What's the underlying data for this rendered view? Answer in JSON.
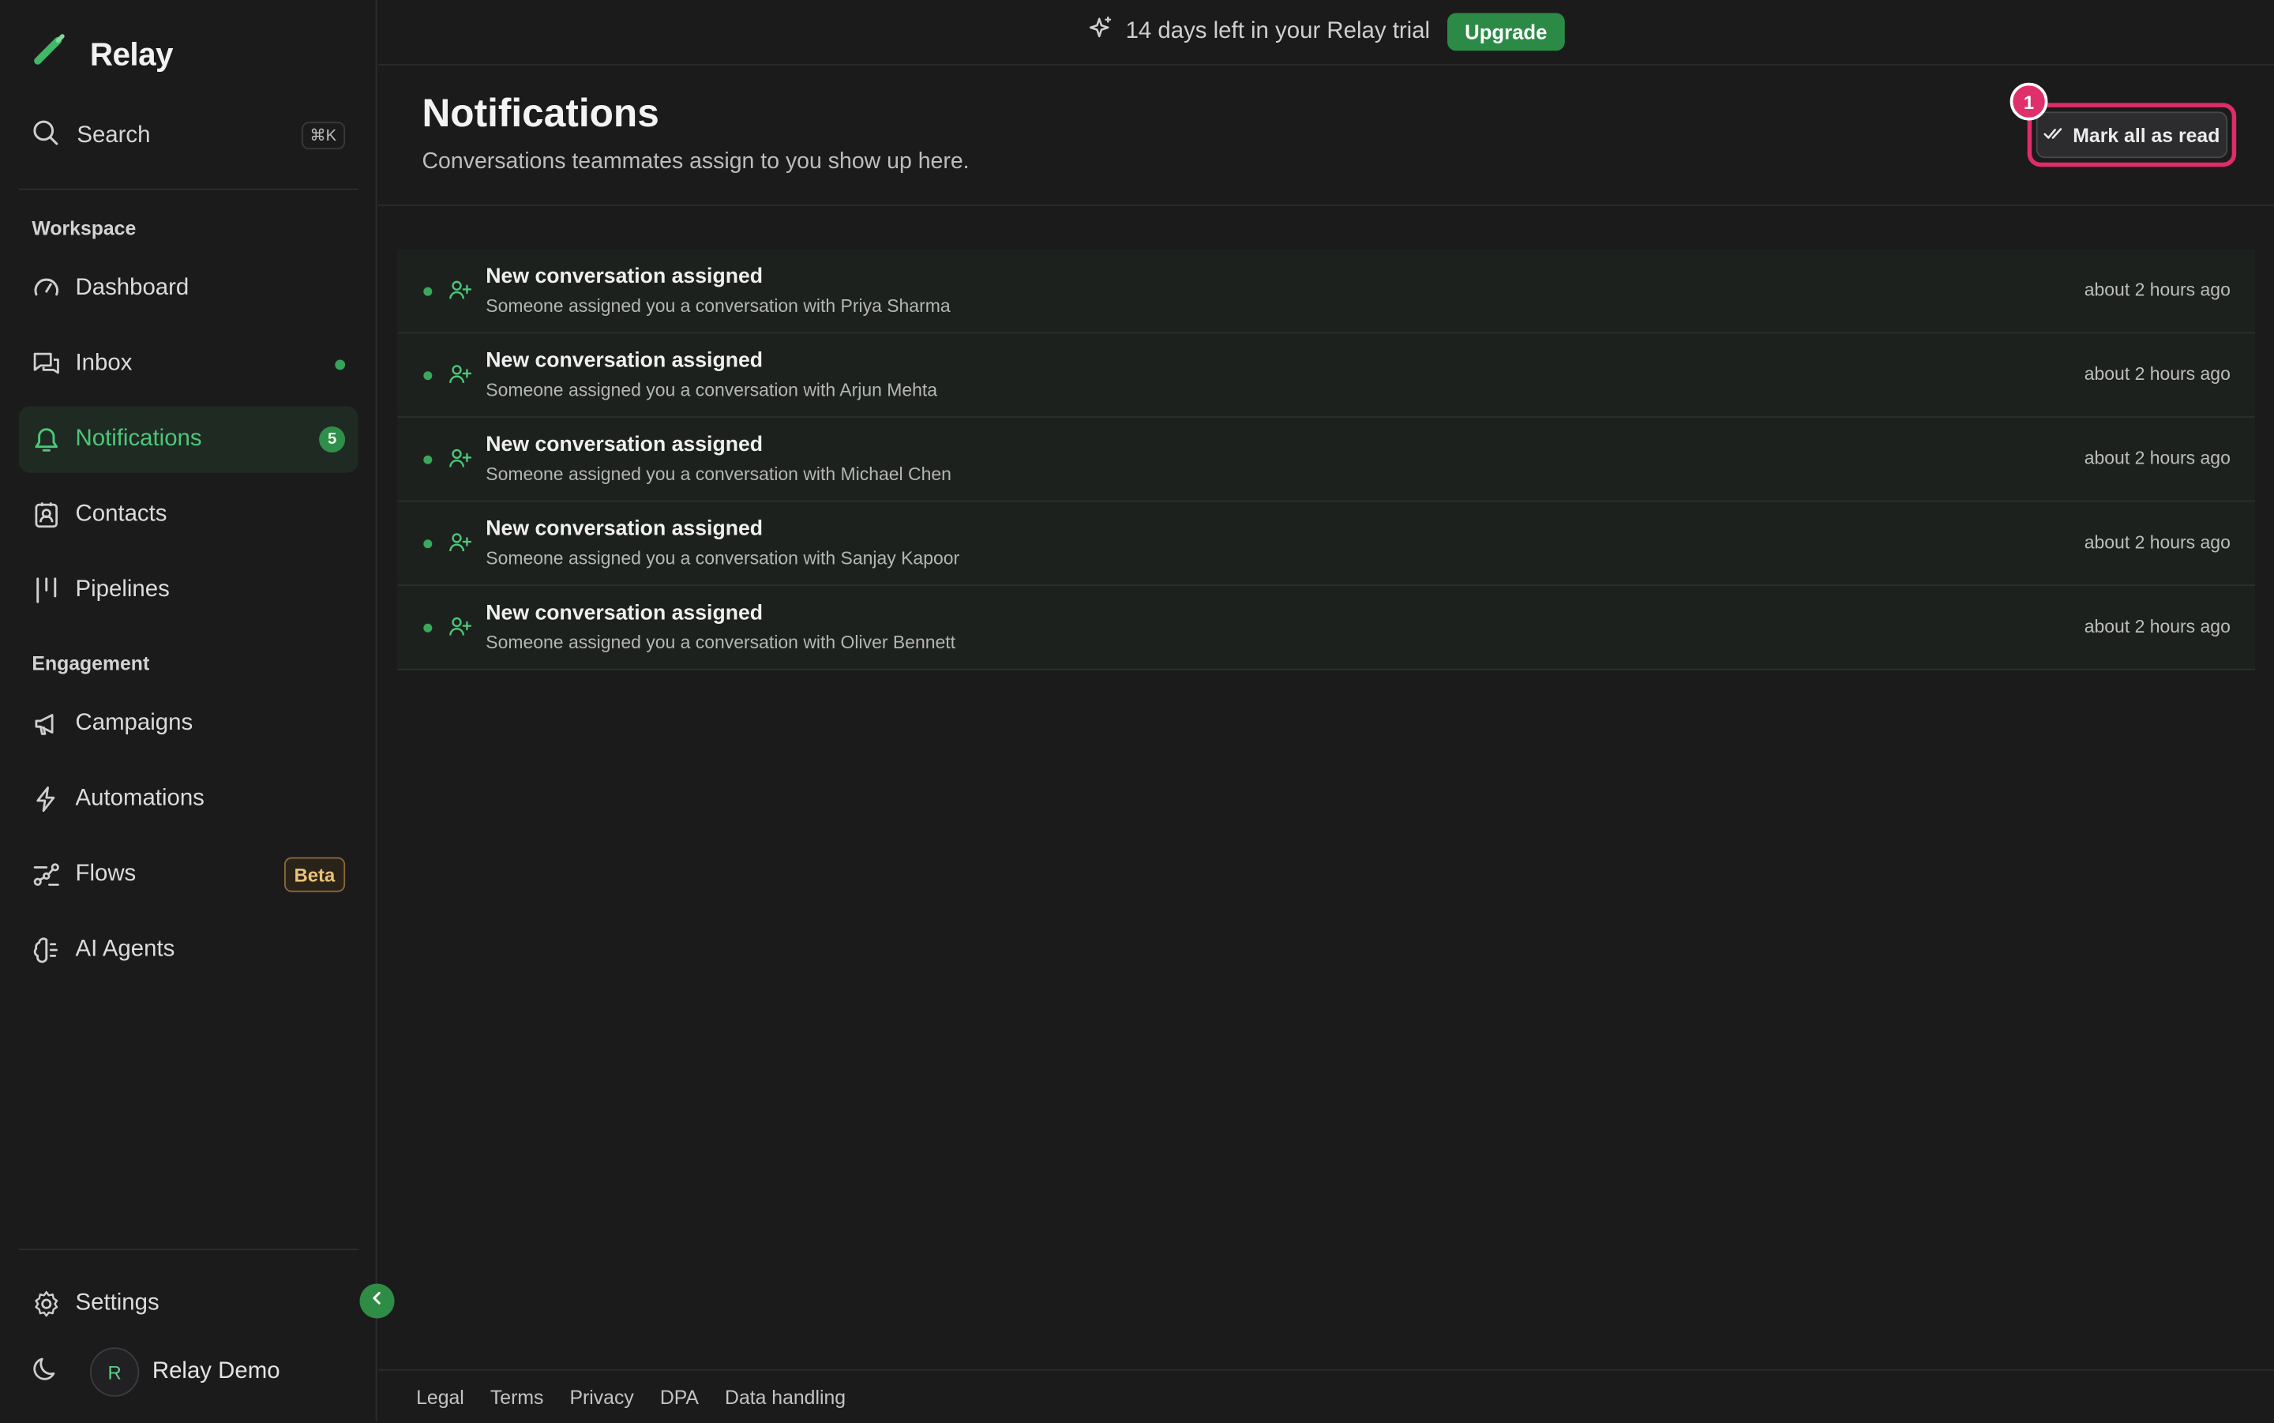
{
  "app": {
    "name": "Relay"
  },
  "search": {
    "label": "Search",
    "shortcut": "⌘K"
  },
  "sidebar": {
    "sections": {
      "workspace": "Workspace",
      "engagement": "Engagement"
    },
    "items": [
      {
        "label": "Dashboard",
        "icon": "gauge-icon"
      },
      {
        "label": "Inbox",
        "icon": "chat-icon",
        "indicator": "dot"
      },
      {
        "label": "Notifications",
        "icon": "bell-icon",
        "count": "5",
        "active": true
      },
      {
        "label": "Contacts",
        "icon": "contact-icon"
      },
      {
        "label": "Pipelines",
        "icon": "pipeline-icon"
      },
      {
        "label": "Campaigns",
        "icon": "megaphone-icon"
      },
      {
        "label": "Automations",
        "icon": "bolt-icon"
      },
      {
        "label": "Flows",
        "icon": "flow-icon",
        "badge": "Beta"
      },
      {
        "label": "AI Agents",
        "icon": "brain-icon"
      }
    ],
    "settings": "Settings",
    "user": {
      "initial": "R",
      "name": "Relay Demo"
    }
  },
  "banner": {
    "text": "14 days left in your Relay trial",
    "cta": "Upgrade"
  },
  "page": {
    "title": "Notifications",
    "subtitle": "Conversations teammates assign to you show up here.",
    "mark_all": "Mark all as read",
    "marker_number": "1"
  },
  "notifications": [
    {
      "title": "New conversation assigned",
      "body": "Someone assigned you a conversation with Priya Sharma",
      "time": "about 2 hours ago"
    },
    {
      "title": "New conversation assigned",
      "body": "Someone assigned you a conversation with Arjun Mehta",
      "time": "about 2 hours ago"
    },
    {
      "title": "New conversation assigned",
      "body": "Someone assigned you a conversation with Michael Chen",
      "time": "about 2 hours ago"
    },
    {
      "title": "New conversation assigned",
      "body": "Someone assigned you a conversation with Sanjay Kapoor",
      "time": "about 2 hours ago"
    },
    {
      "title": "New conversation assigned",
      "body": "Someone assigned you a conversation with Oliver Bennett",
      "time": "about 2 hours ago"
    }
  ],
  "footer": {
    "links": [
      "Legal",
      "Terms",
      "Privacy",
      "DPA",
      "Data handling"
    ]
  },
  "colors": {
    "accent": "#2b8a45",
    "active_text": "#4cc77a",
    "highlight": "#e02c6a"
  }
}
